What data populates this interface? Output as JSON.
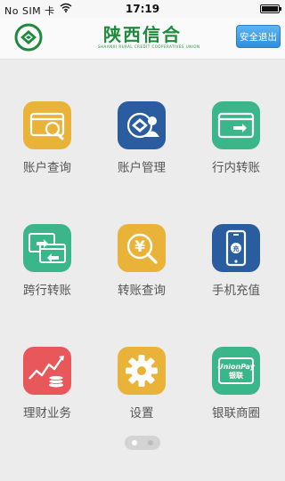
{
  "status_bar": {
    "carrier": "No SIM 卡",
    "time": "17:19",
    "wifi_icon": "wifi-icon",
    "battery_icon": "battery-icon"
  },
  "header": {
    "brand_name": "陕西信合",
    "brand_subtitle": "SHAANXI RURAL CREDIT COOPERATIVES UNION",
    "logout_label": "安全退出",
    "logo_icon": "rural-credit-logo-icon"
  },
  "tiles": [
    {
      "label": "账户查询",
      "icon": "card-search-icon",
      "color": "#e9b33a"
    },
    {
      "label": "账户管理",
      "icon": "account-manage-icon",
      "color": "#2a5d9f"
    },
    {
      "label": "行内转账",
      "icon": "card-transfer-icon",
      "color": "#3bb58a"
    },
    {
      "label": "跨行转账",
      "icon": "interbank-transfer-icon",
      "color": "#3bb58a"
    },
    {
      "label": "转账查询",
      "icon": "transfer-query-icon",
      "color": "#e9b33a"
    },
    {
      "label": "手机充值",
      "icon": "phone-topup-icon",
      "color": "#2a5d9f"
    },
    {
      "label": "理财业务",
      "icon": "wealth-growth-icon",
      "color": "#e8585a"
    },
    {
      "label": "设置",
      "icon": "gear-icon",
      "color": "#e9b33a"
    },
    {
      "label": "银联商圈",
      "icon": "unionpay-icon",
      "color": "#3bb58a"
    }
  ],
  "unionpay_text": {
    "line1": "UnionPay",
    "line2": "银联"
  },
  "topup_text": "充",
  "yen_symbol": "¥",
  "pager": {
    "pages": 2,
    "current": 1
  }
}
